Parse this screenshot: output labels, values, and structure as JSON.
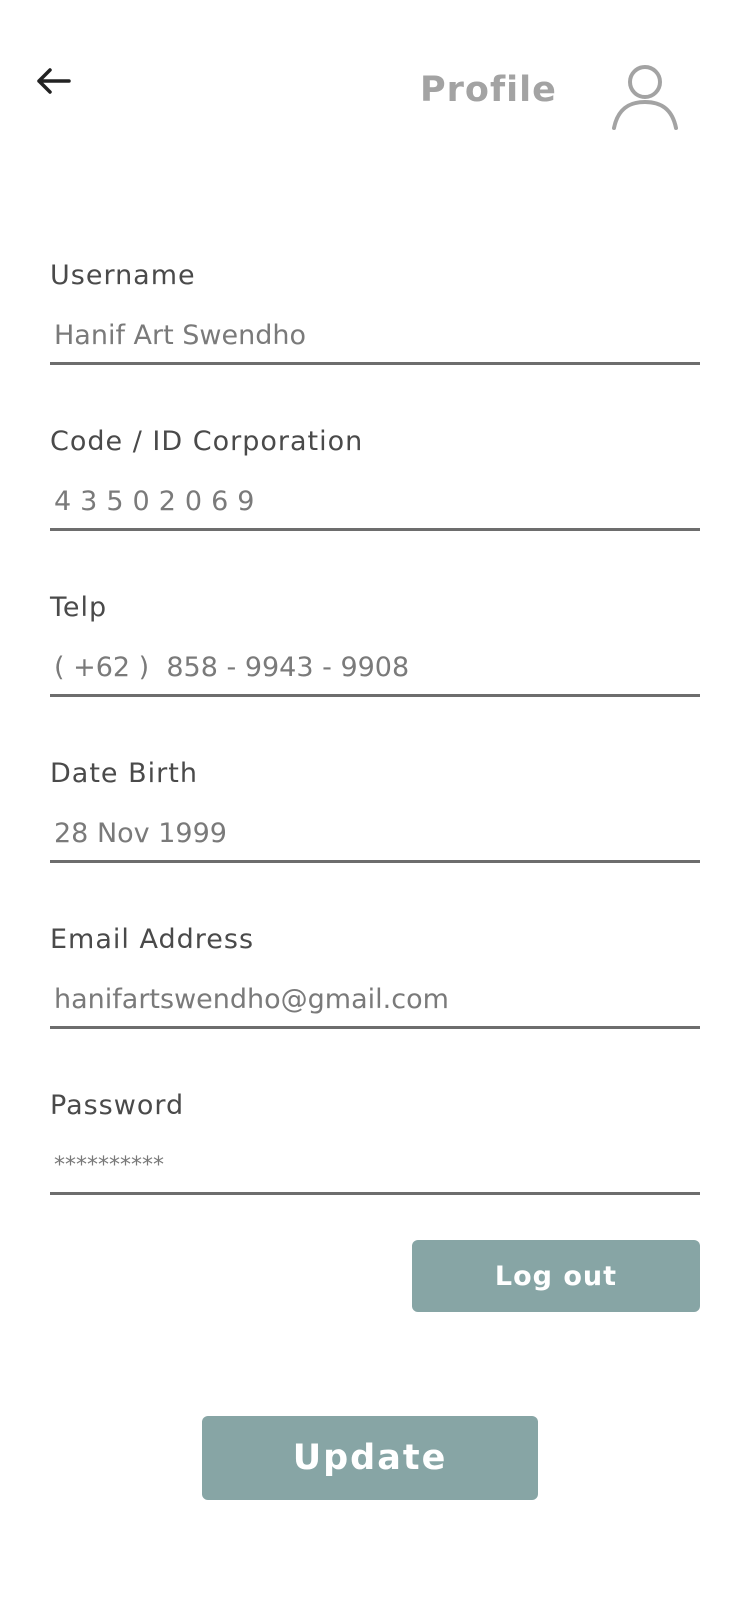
{
  "header": {
    "title": "Profile",
    "back_icon": "arrow-left-icon",
    "avatar_icon": "user-icon"
  },
  "form": {
    "fields": [
      {
        "label": "Username",
        "value": "Hanif Art Swendho"
      },
      {
        "label": "Code / ID Corporation",
        "value": "43502069"
      },
      {
        "label": "Telp",
        "value": "( +62 )  858 - 9943 - 9908"
      },
      {
        "label": "Date Birth",
        "value": "28 Nov 1999"
      },
      {
        "label": "Email Address",
        "value": "hanifartswendho@gmail.com"
      },
      {
        "label": "Password",
        "value": "**********"
      }
    ]
  },
  "actions": {
    "logout_label": "Log out",
    "update_label": "Update"
  },
  "colors": {
    "button": "#87a5a5",
    "title": "#a3a3a3",
    "label": "#4a4a4a",
    "value": "#7a7a7a",
    "underline": "#6d6d6d"
  }
}
